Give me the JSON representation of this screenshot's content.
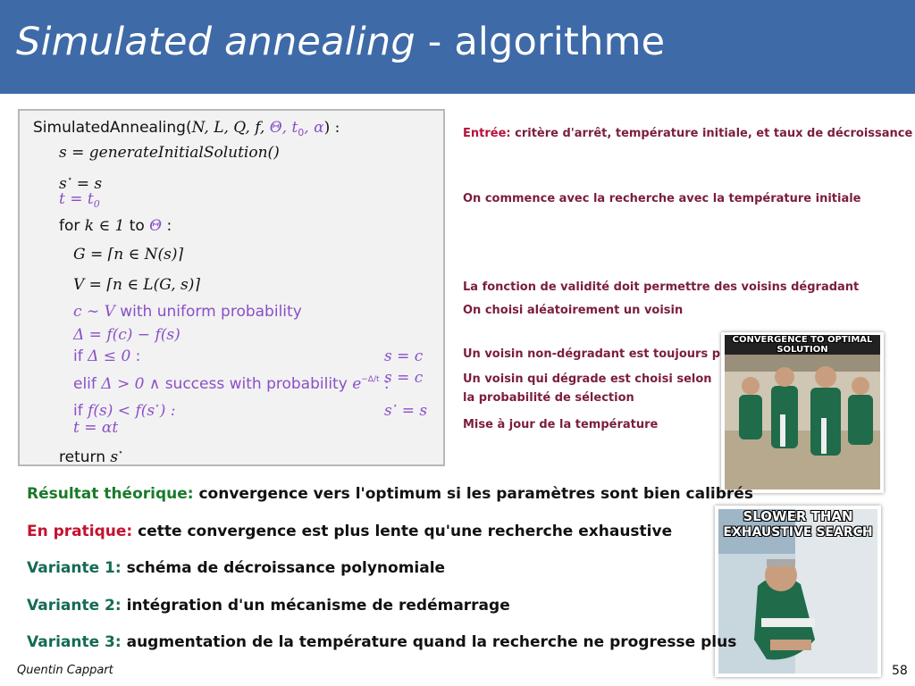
{
  "title": {
    "italic": "Simulated annealing",
    "rest": " - algorithme"
  },
  "algorithm": {
    "l1_name": "SimulatedAnnealing(",
    "l1_args": "N, L, Q, f, ",
    "l1_purple": "Θ, t",
    "l1_sub": "0",
    "l1_alpha": ", α",
    "l1_end": ") :",
    "l2": "s = generateInitialSolution()",
    "l3": "s",
    "l3_sup": "⋆",
    "l3_end": " = s",
    "l4": "t = t",
    "l4_sub": "0",
    "l5_a": "for ",
    "l5_b": "k ∈ 1",
    "l5_c": " to ",
    "l5_d": "Θ",
    "l5_e": " :",
    "l6": "G = ⌈n ∈ N(s)⌉",
    "l7": "V = ⌈n ∈ L(G, s)⌉",
    "l8_a": "c ∼ V",
    "l8_b": " with uniform probability",
    "l9": "Δ = f(c) − f(s)",
    "l10_a": "if ",
    "l10_b": "Δ ≤ 0",
    "l10_c": " :",
    "l10_r": "s = c",
    "l11_a": "elif ",
    "l11_b": "Δ > 0 ∧",
    "l11_c": " success with probability ",
    "l11_d": "e",
    "l11_sup": "−Δ/t",
    "l11_e": " :",
    "l11_r": "s = c",
    "l12_a": "if ",
    "l12_b": "f(s) < f(s",
    "l12_sup": "⋆",
    "l12_c": ") :",
    "l12_r": "s",
    "l12_rsup": "⋆",
    "l12_rend": " = s",
    "l13": "t = αt",
    "l14_a": "return ",
    "l14_b": "s",
    "l14_sup": "⋆"
  },
  "notes": {
    "n1_key": "Entrée:",
    "n1_text": " critère d'arrêt, température initiale, et taux de décroissance",
    "n2": "On commence avec la recherche avec la température initiale",
    "n3": "La fonction de validité doit permettre des voisins dégradant",
    "n4": "On choisi aléatoirement un voisin",
    "n5": "Un voisin non-dégradant est toujours pris",
    "n6": "Un voisin qui dégrade est choisi selon",
    "n7": "la probabilité de sélection",
    "n8": "Mise à jour de la température"
  },
  "memes": {
    "m1_caption": "CONVERGENCE TO OPTIMAL SOLUTION",
    "m2_caption_1": "SLOWER THAN",
    "m2_caption_2": "EXHAUSTIVE SEARCH"
  },
  "results": {
    "r1_label": "Résultat théorique:",
    "r1_text": " convergence vers l'optimum si les paramètres sont bien calibrés",
    "r2_label": "En pratique:",
    "r2_text": " cette convergence est plus lente qu'une recherche exhaustive",
    "r3_label": "Variante 1:",
    "r3_text": " schéma de décroissance polynomiale",
    "r4_label": "Variante 2:",
    "r4_text": " intégration d'un mécanisme de redémarrage",
    "r5_label": "Variante 3:",
    "r5_text": " augmentation de la température quand la recherche ne progresse plus"
  },
  "footer": {
    "author": "Quentin Cappart",
    "page": "58"
  },
  "colors": {
    "title_bg": "#3e6aa8",
    "purple": "#8a4fc7",
    "note": "#7b1e3a",
    "green": "#1a7a2a",
    "red": "#c4122f"
  }
}
